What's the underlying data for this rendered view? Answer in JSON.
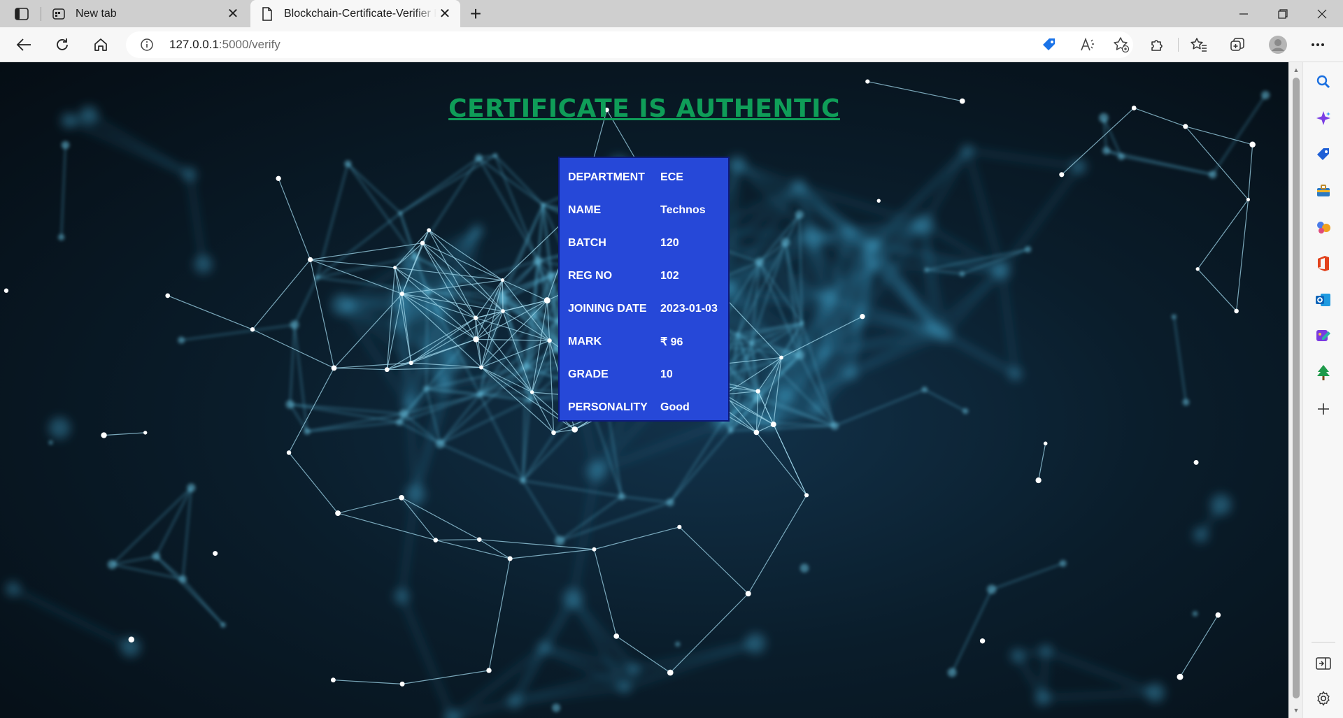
{
  "browser": {
    "tabs": [
      {
        "title": "New tab",
        "favicon": "newtab-icon",
        "active": false
      },
      {
        "title": "Blockchain-Certificate-Verifier Re",
        "favicon": "page-icon",
        "active": true
      }
    ],
    "address": {
      "host": "127.0.0.1",
      "path": ":5000/verify"
    },
    "toolbar_icons": [
      "back-icon",
      "refresh-icon",
      "home-icon",
      "site-info-icon",
      "shopping-tag-icon",
      "read-aloud-icon",
      "add-favorite-icon",
      "extensions-icon",
      "favorites-icon",
      "collections-icon",
      "profile-icon",
      "more-icon"
    ],
    "sidebar_icons": [
      "search-icon",
      "copilot-icon",
      "shopping-icon",
      "tools-icon",
      "games-icon",
      "office-icon",
      "outlook-icon",
      "designer-icon",
      "tree-icon",
      "add-icon",
      "hide-sidebar-icon",
      "settings-icon"
    ]
  },
  "page": {
    "headline": "CERTIFICATE IS AUTHENTIC",
    "headline_color": "#0f9d58",
    "card_color": "#2648d8",
    "certificate": [
      {
        "label": "DEPARTMENT",
        "value": "ECE"
      },
      {
        "label": "NAME",
        "value": "Technos"
      },
      {
        "label": "BATCH",
        "value": "120"
      },
      {
        "label": "REG NO",
        "value": "102"
      },
      {
        "label": "JOINING DATE",
        "value": "2023-01-03"
      },
      {
        "label": "MARK",
        "value": "₹ 96"
      },
      {
        "label": "GRADE",
        "value": "10"
      },
      {
        "label": "PERSONALITY",
        "value": "Good"
      }
    ]
  }
}
